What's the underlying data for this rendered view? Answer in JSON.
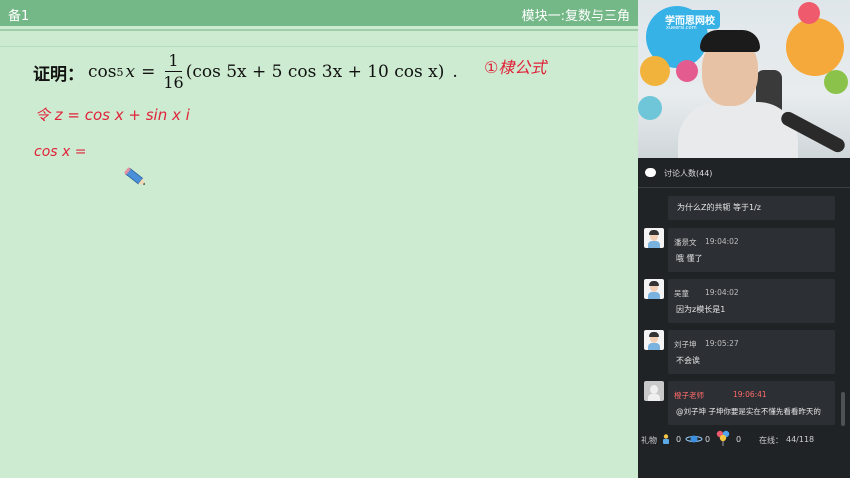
{
  "board": {
    "header_left": "备1",
    "header_right": "模块一:复数与三角",
    "proof": {
      "label": "证明：",
      "lhs_fn": "cos",
      "lhs_exp": "5",
      "lhs_var": "x",
      "equals": "=",
      "frac_num": "1",
      "frac_den": "16",
      "rhs": "(cos 5x + 5 cos 3x + 10 cos x)",
      "end": "."
    },
    "handwriting": {
      "formula_note": "①棣公式",
      "let_line": "令  z = cos x + sin x i",
      "cos_line": "cos x ="
    },
    "accent_color": "#e0233a"
  },
  "side": {
    "logo": "学而思网校",
    "logo_sub": "xueersi.com",
    "chat_title": "讨论人数(44)",
    "first_message": "为什么Z的共轭 等于1/z",
    "messages": [
      {
        "name": "潘景文",
        "time": "19:04:02",
        "text": "哦  懂了",
        "teacher": false
      },
      {
        "name": "吴童",
        "time": "19:04:02",
        "text": "因为z模长是1",
        "teacher": false
      },
      {
        "name": "刘子坤",
        "time": "19:05:27",
        "text": "不会诶",
        "teacher": false
      },
      {
        "name": "橙子老师",
        "time": "19:06:41",
        "text": "@刘子坤 子坤你要是实在不懂先看看昨天的",
        "teacher": true
      }
    ],
    "footer": {
      "gifts_label": "礼物",
      "gift_counts": [
        "0",
        "0",
        "0"
      ],
      "online_label": "在线：",
      "online_value": "44/118"
    }
  }
}
